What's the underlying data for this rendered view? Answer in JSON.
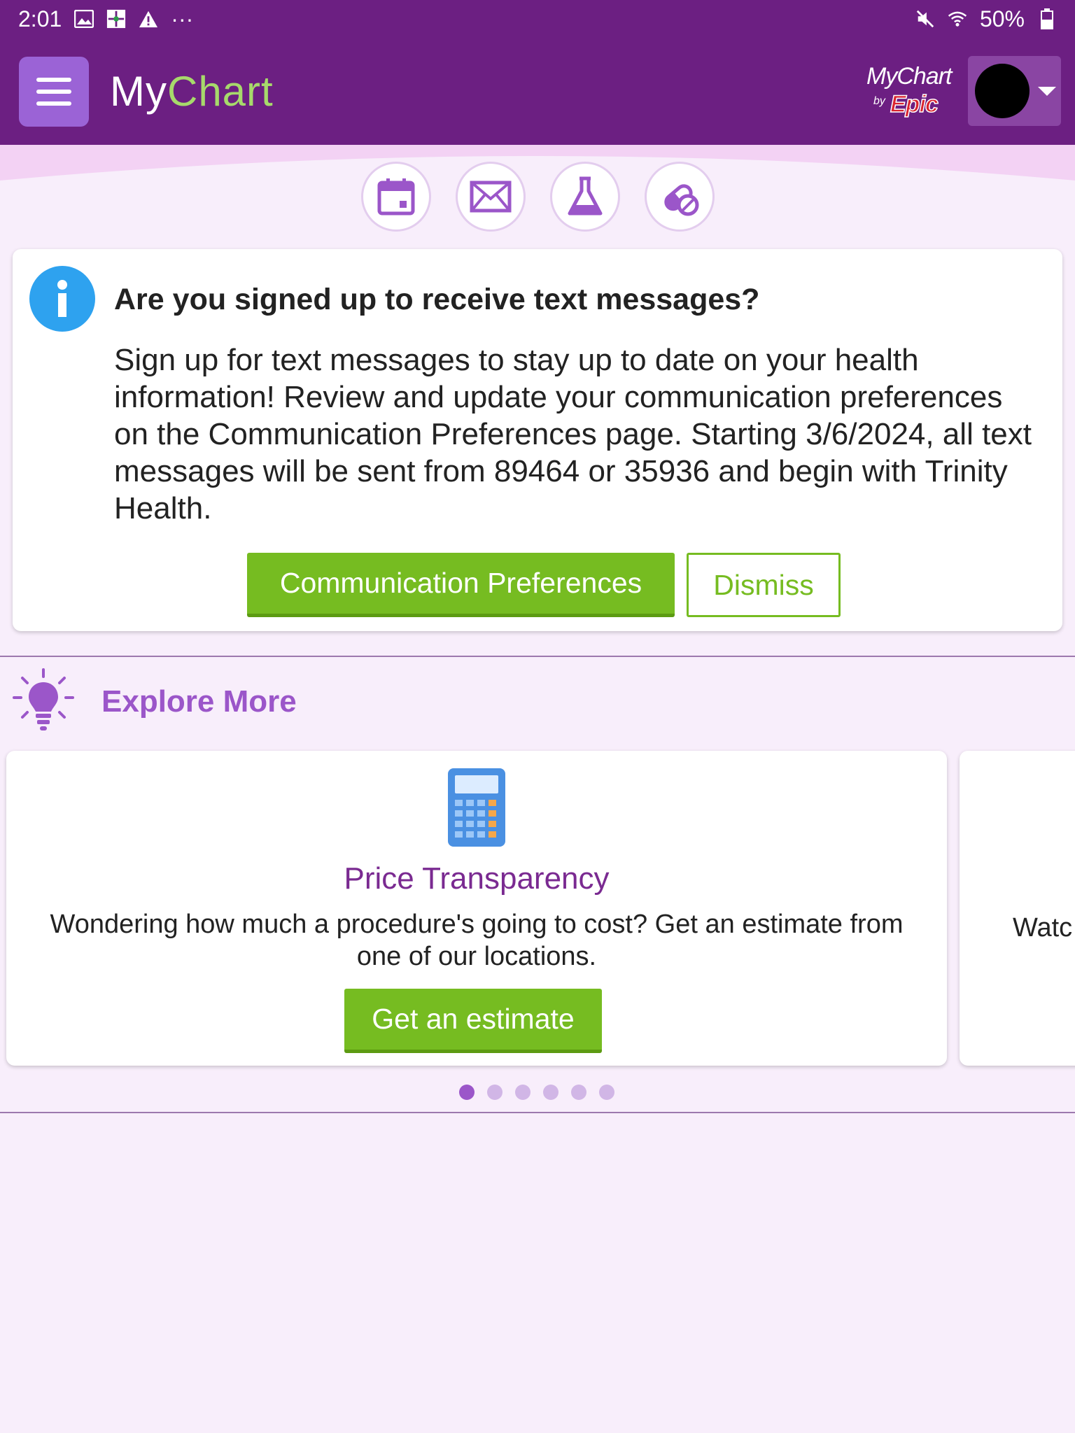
{
  "status_bar": {
    "time": "2:01",
    "more": "···",
    "battery": "50%",
    "icons": [
      "image-icon",
      "app-icon",
      "warning-icon",
      "mute-icon",
      "wifi-icon",
      "battery-icon"
    ]
  },
  "header": {
    "logo_my": "My",
    "logo_chart": "Chart",
    "epic_mychart": "MyChart",
    "epic_by": "by",
    "epic_name": "Epic",
    "colors": {
      "header_bg": "#6c1f82",
      "accent_green": "#a7d96b"
    }
  },
  "quick_actions": [
    {
      "name": "appointments",
      "icon": "calendar-icon"
    },
    {
      "name": "messages",
      "icon": "envelope-icon"
    },
    {
      "name": "test-results",
      "icon": "flask-icon"
    },
    {
      "name": "medications",
      "icon": "pill-icon"
    }
  ],
  "alert": {
    "title": "Are you signed up to receive text messages?",
    "body": "Sign up for text messages to stay up to date on your health information! Review and update your communication preferences on the Communication Preferences page.  Starting 3/6/2024, all text messages will be sent from 89464 or 35936 and begin with Trinity Health.",
    "primary_label": "Communication Preferences",
    "secondary_label": "Dismiss"
  },
  "explore": {
    "title": "Explore More",
    "card": {
      "title": "Price Transparency",
      "description": "Wondering how much a procedure's going to cost? Get an estimate from one of our locations.",
      "button_label": "Get an estimate"
    },
    "next_card_peek": "Watc",
    "page_count": 6,
    "active_page": 1
  }
}
